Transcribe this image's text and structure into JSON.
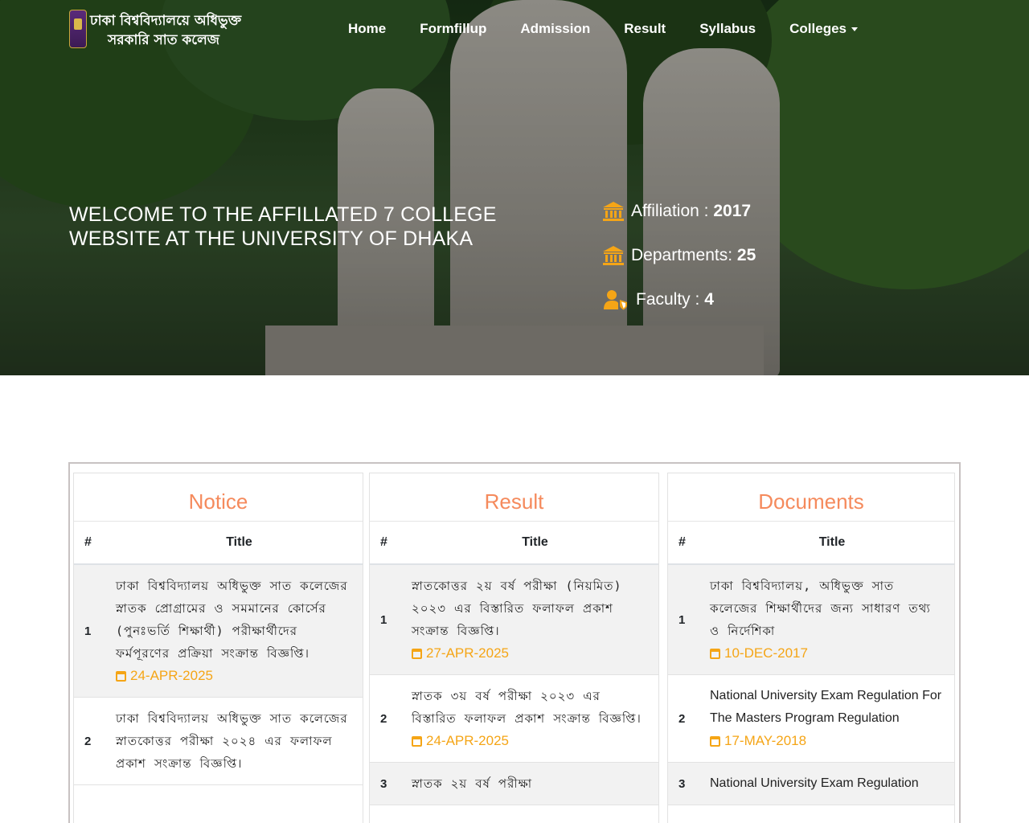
{
  "brand": {
    "line1": "ঢাকা বিশ্ববিদ্যালয়ে অধিভুক্ত",
    "line2": "সরকারি সাত কলেজ"
  },
  "nav": {
    "items": [
      {
        "label": "Home"
      },
      {
        "label": "Formfillup"
      },
      {
        "label": "Admission"
      },
      {
        "label": "Result"
      },
      {
        "label": "Syllabus"
      },
      {
        "label": "Colleges"
      }
    ]
  },
  "hero": {
    "welcome": "WELCOME TO THE AFFILLATED 7 COLLEGE WEBSITE AT THE UNIVERSITY OF DHAKA",
    "stats": [
      {
        "label": "Affiliation :",
        "value": "2017",
        "icon": "bank-icon"
      },
      {
        "label": "Departments:",
        "value": "25",
        "icon": "bank-icon"
      },
      {
        "label": "Faculty :",
        "value": "4",
        "icon": "user-shield-icon"
      }
    ]
  },
  "sections": {
    "header_num": "#",
    "header_title": "Title",
    "notice": {
      "title": "Notice",
      "rows": [
        {
          "num": "1",
          "title": "ঢাকা বিশ্ববিদ্যালয় অধিভুক্ত সাত কলেজের স্নাতক প্রোগ্রামের ও সমমানের কোর্সের (পুনঃভর্তি শিক্ষার্থী) পরীক্ষার্থীদের ফর্মপূরণের প্রক্রিয়া সংক্রান্ত বিজ্ঞপ্তি।",
          "date": "24-APR-2025"
        },
        {
          "num": "2",
          "title": "ঢাকা বিশ্ববিদ্যালয় অধিভুক্ত সাত কলেজের স্নাতকোত্তর পরীক্ষা ২০২৪ এর ফলাফল প্রকাশ সংক্রান্ত বিজ্ঞপ্তি।",
          "date": ""
        }
      ]
    },
    "result": {
      "title": "Result",
      "rows": [
        {
          "num": "1",
          "title": "স্নাতকোত্তর ২য় বর্ষ পরীক্ষা (নিয়মিত) ২০২৩ এর বিস্তারিত ফলাফল প্রকাশ সংক্রান্ত বিজ্ঞপ্তি।",
          "date": "27-APR-2025"
        },
        {
          "num": "2",
          "title": "স্নাতক ৩য় বর্ষ পরীক্ষা ২০২৩ এর বিস্তারিত ফলাফল প্রকাশ সংক্রান্ত বিজ্ঞপ্তি।",
          "date": "24-APR-2025"
        },
        {
          "num": "3",
          "title": "স্নাতক ২য় বর্ষ পরীক্ষা",
          "date": ""
        }
      ]
    },
    "documents": {
      "title": "Documents",
      "rows": [
        {
          "num": "1",
          "title": "ঢাকা বিশ্ববিদ্যালয়, অধিভুক্ত সাত কলেজের শিক্ষার্থীদের জন্য সাধারণ তথ্য ও নির্দেশিকা",
          "date": "10-DEC-2017"
        },
        {
          "num": "2",
          "title": "National University Exam Regulation For The Masters Program Regulation",
          "date": "17-MAY-2018"
        },
        {
          "num": "3",
          "title": "National University Exam Regulation",
          "date": ""
        }
      ]
    }
  }
}
